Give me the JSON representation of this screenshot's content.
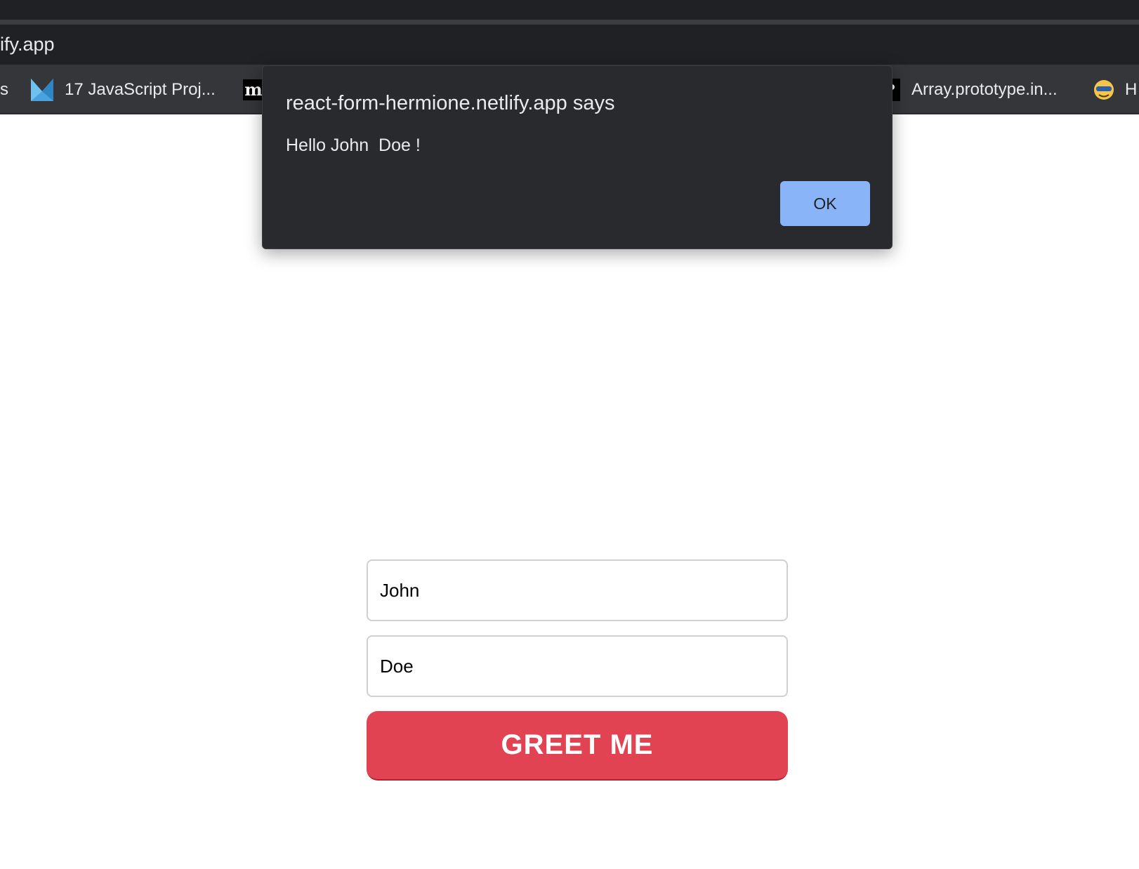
{
  "browser": {
    "url_fragment": "ify.app",
    "bookmarks": [
      {
        "label": "s",
        "icon": "none"
      },
      {
        "label": "17 JavaScript Proj...",
        "icon": "m-logo-icon"
      },
      {
        "label": "",
        "icon": "medium-m-icon"
      },
      {
        "label": "Array.prototype.in...",
        "icon": "black-square-icon"
      },
      {
        "label": "H",
        "icon": "cartoon-face-icon"
      }
    ]
  },
  "dialog": {
    "title": "react-form-hermione.netlify.app says",
    "message": "Hello John  Doe !",
    "ok_label": "OK"
  },
  "form": {
    "first_name": "John",
    "last_name": "Doe",
    "submit_label": "GREET ME"
  },
  "colors": {
    "chrome_dark": "#202124",
    "bookmarks_bar": "#35363a",
    "dialog_bg": "#292a2d",
    "ok_button": "#8ab4f8",
    "greet_button": "#e24353"
  }
}
